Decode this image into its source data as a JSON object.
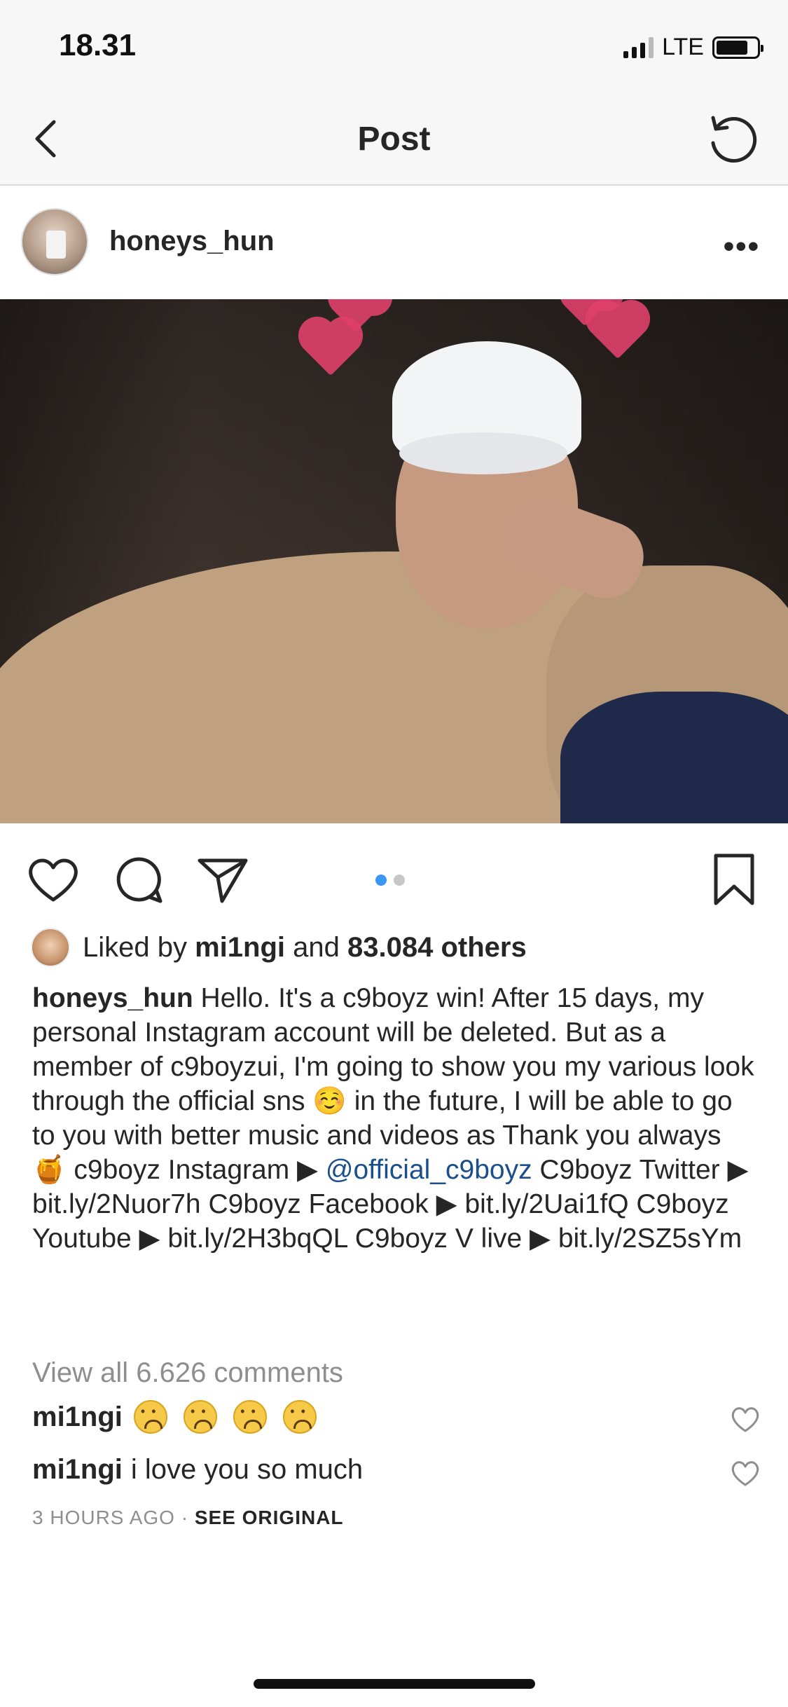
{
  "status_bar": {
    "time": "18.31",
    "network": "LTE",
    "battery_level": 0.78
  },
  "nav": {
    "title": "Post",
    "back_icon": "chevron-left-icon",
    "refresh_icon": "refresh-icon"
  },
  "post": {
    "username": "honeys_hun",
    "more_label": "•••",
    "carousel": {
      "count": 2,
      "active_index": 0
    },
    "likes": {
      "prefix": "Liked by",
      "liker": "mi1ngi",
      "middle": "and",
      "count_text": "83.084 others"
    },
    "caption": {
      "author": "honeys_hun",
      "part1": "Hello. It's a c9boyz win! After 15 days, my personal Instagram account will be deleted. But as a member of c9boyzui, I'm going to show you my various look through the official sns ☺️ in the future, I will be able to go to you with better music and videos as Thank you always 🍯 ",
      "part2": "c9boyz Instagram ▶ ",
      "mention": "@official_c9boyz",
      "part3": " C9boyz Twitter ▶ bit.ly/2Nuor7h C9boyz Facebook ▶ bit.ly/2Uai1fQ C9boyz Youtube ▶ bit.ly/2H3bqQL C9boyz V live ▶ bit.ly/2SZ5sYm"
    },
    "view_comments": "View all 6.626 comments",
    "comments": [
      {
        "user": "mi1ngi",
        "text": "",
        "emoji_count": 4
      },
      {
        "user": "mi1ngi",
        "text": "i love you so much",
        "emoji_count": 0
      }
    ],
    "time_ago": "3 HOURS AGO",
    "separator": "·",
    "see_original": "SEE ORIGINAL"
  }
}
